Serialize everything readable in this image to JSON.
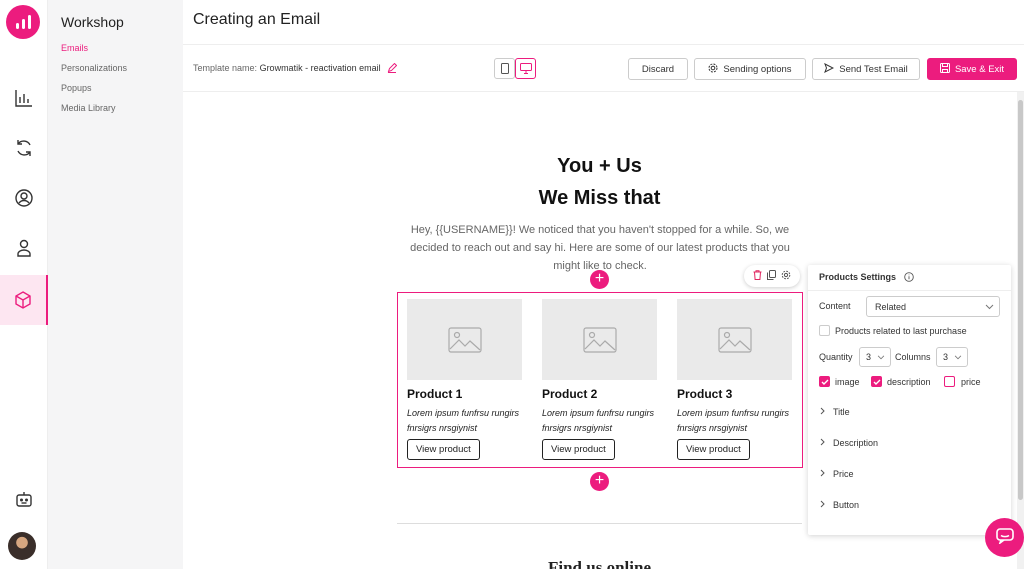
{
  "app": {
    "section_title": "Workshop",
    "page_title": "Creating an Email"
  },
  "rail": {
    "items": [
      {
        "icon": "analytics-icon"
      },
      {
        "icon": "sync-icon"
      },
      {
        "icon": "user-circle-icon"
      },
      {
        "icon": "person-icon"
      },
      {
        "icon": "cube-icon",
        "active": true
      }
    ],
    "bottom": [
      {
        "icon": "bot-icon"
      },
      {
        "icon": "avatar"
      }
    ]
  },
  "nav": {
    "items": [
      {
        "label": "Emails",
        "active": true
      },
      {
        "label": "Personalizations"
      },
      {
        "label": "Popups"
      },
      {
        "label": "Media Library"
      }
    ]
  },
  "toolbar": {
    "template_label": "Template name:",
    "template_name": "Growmatik - reactivation email",
    "discard": "Discard",
    "sending_options": "Sending options",
    "send_test": "Send Test Email",
    "save_exit": "Save & Exit"
  },
  "email": {
    "heading_line1": "You + Us",
    "heading_line2": "We Miss that",
    "intro": "Hey, {{USERNAME}}! We noticed that you haven't stopped for a while. So, we decided to reach out and say hi. Here are some of our latest products that you might like to check.",
    "products": [
      {
        "name": "Product 1",
        "desc": "Lorem ipsum funfrsu rungirs fnrsigrs nrsgiynist",
        "button": "View product"
      },
      {
        "name": "Product 2",
        "desc": "Lorem ipsum funfrsu rungirs fnrsigrs nrsgiynist",
        "button": "View product"
      },
      {
        "name": "Product 3",
        "desc": "Lorem ipsum funfrsu rungirs fnrsigrs nrsgiynist",
        "button": "View product"
      }
    ],
    "footer_heading": "Find us online"
  },
  "panel": {
    "title": "Products Settings",
    "content_label": "Content",
    "content_value": "Related",
    "related_checkbox": "Products related to last purchase",
    "quantity_label": "Quantity",
    "quantity_value": "3",
    "columns_label": "Columns",
    "columns_value": "3",
    "opt_image": "image",
    "opt_description": "description",
    "opt_price": "price",
    "sections": [
      "Title",
      "Description",
      "Price",
      "Button"
    ]
  },
  "colors": {
    "accent": "#ec1c7e"
  }
}
